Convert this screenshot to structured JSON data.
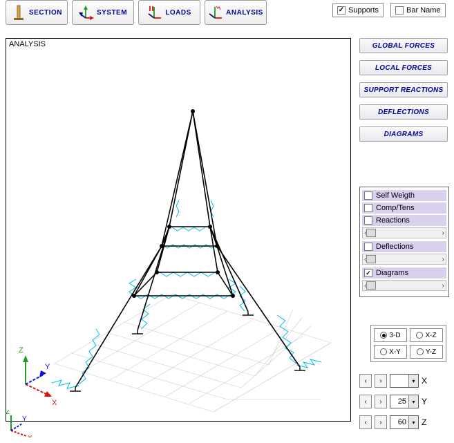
{
  "toolbar": {
    "section": "SECTION",
    "system": "SYSTEM",
    "loads": "LOADS",
    "analysis": "ANALYSIS"
  },
  "display_toggles": {
    "supports_label": "Supports",
    "supports_checked": true,
    "barname_label": "Bar Name",
    "barname_checked": false
  },
  "viewport": {
    "mode_label": "ANALYSIS",
    "axis_labels": {
      "x": "X",
      "y": "Y",
      "z": "Z"
    }
  },
  "result_panels": {
    "global_forces": "GLOBAL FORCES",
    "local_forces": "LOCAL FORCES",
    "support_reactions": "SUPPORT REACTIONS",
    "deflections": "DEFLECTIONS",
    "diagrams": "DIAGRAMS"
  },
  "options": {
    "self_weight": {
      "label": "Self Weigth",
      "checked": false
    },
    "comp_tens": {
      "label": "Comp/Tens",
      "checked": false
    },
    "reactions": {
      "label": "Reactions",
      "checked": false
    },
    "deflections": {
      "label": "Deflections",
      "checked": false
    },
    "diagrams": {
      "label": "Diagrams",
      "checked": true
    }
  },
  "view_buttons": {
    "v3d": "3-D",
    "xz": "X-Z",
    "xy": "X-Y",
    "yz": "Y-Z",
    "selected": "3-D"
  },
  "rotation": {
    "x": {
      "value": "",
      "axis": "X"
    },
    "y": {
      "value": "25",
      "axis": "Y"
    },
    "z": {
      "value": "60",
      "axis": "Z"
    }
  },
  "chart_data": {
    "type": "3d-frame-analysis",
    "description": "Isometric view of a 4-legged space-frame tower with internal-force/diagram hatching (cyan) along members",
    "visual_overlays": [
      "diagrams"
    ],
    "axes_shown": [
      "X",
      "Y",
      "Z"
    ],
    "nodes": [
      {
        "id": 1,
        "x": -3.0,
        "y": -3.0,
        "z": 0.0,
        "support": "pinned"
      },
      {
        "id": 2,
        "x": 3.0,
        "y": -3.0,
        "z": 0.0,
        "support": "pinned"
      },
      {
        "id": 3,
        "x": 3.0,
        "y": 3.0,
        "z": 0.0,
        "support": "pinned"
      },
      {
        "id": 4,
        "x": -3.0,
        "y": 3.0,
        "z": 0.0,
        "support": "pinned"
      },
      {
        "id": 5,
        "x": -1.2,
        "y": -1.2,
        "z": 3.5
      },
      {
        "id": 6,
        "x": 1.2,
        "y": -1.2,
        "z": 3.5
      },
      {
        "id": 7,
        "x": 1.2,
        "y": 1.2,
        "z": 3.5
      },
      {
        "id": 8,
        "x": -1.2,
        "y": 1.2,
        "z": 3.5
      },
      {
        "id": 9,
        "x": -0.7,
        "y": -0.7,
        "z": 5.5
      },
      {
        "id": 10,
        "x": 0.7,
        "y": -0.7,
        "z": 5.5
      },
      {
        "id": 11,
        "x": 0.7,
        "y": 0.7,
        "z": 5.5
      },
      {
        "id": 12,
        "x": -0.7,
        "y": 0.7,
        "z": 5.5
      },
      {
        "id": 13,
        "x": 0.0,
        "y": 0.0,
        "z": 9.5
      }
    ],
    "bars": [
      {
        "i": 1,
        "j": 5
      },
      {
        "i": 2,
        "j": 6
      },
      {
        "i": 3,
        "j": 7
      },
      {
        "i": 4,
        "j": 8
      },
      {
        "i": 5,
        "j": 6
      },
      {
        "i": 6,
        "j": 7
      },
      {
        "i": 7,
        "j": 8
      },
      {
        "i": 8,
        "j": 5
      },
      {
        "i": 5,
        "j": 9
      },
      {
        "i": 6,
        "j": 10
      },
      {
        "i": 7,
        "j": 11
      },
      {
        "i": 8,
        "j": 12
      },
      {
        "i": 9,
        "j": 10
      },
      {
        "i": 10,
        "j": 11
      },
      {
        "i": 11,
        "j": 12
      },
      {
        "i": 12,
        "j": 9
      },
      {
        "i": 9,
        "j": 13
      },
      {
        "i": 10,
        "j": 13
      },
      {
        "i": 11,
        "j": 13
      },
      {
        "i": 12,
        "j": 13
      }
    ]
  }
}
